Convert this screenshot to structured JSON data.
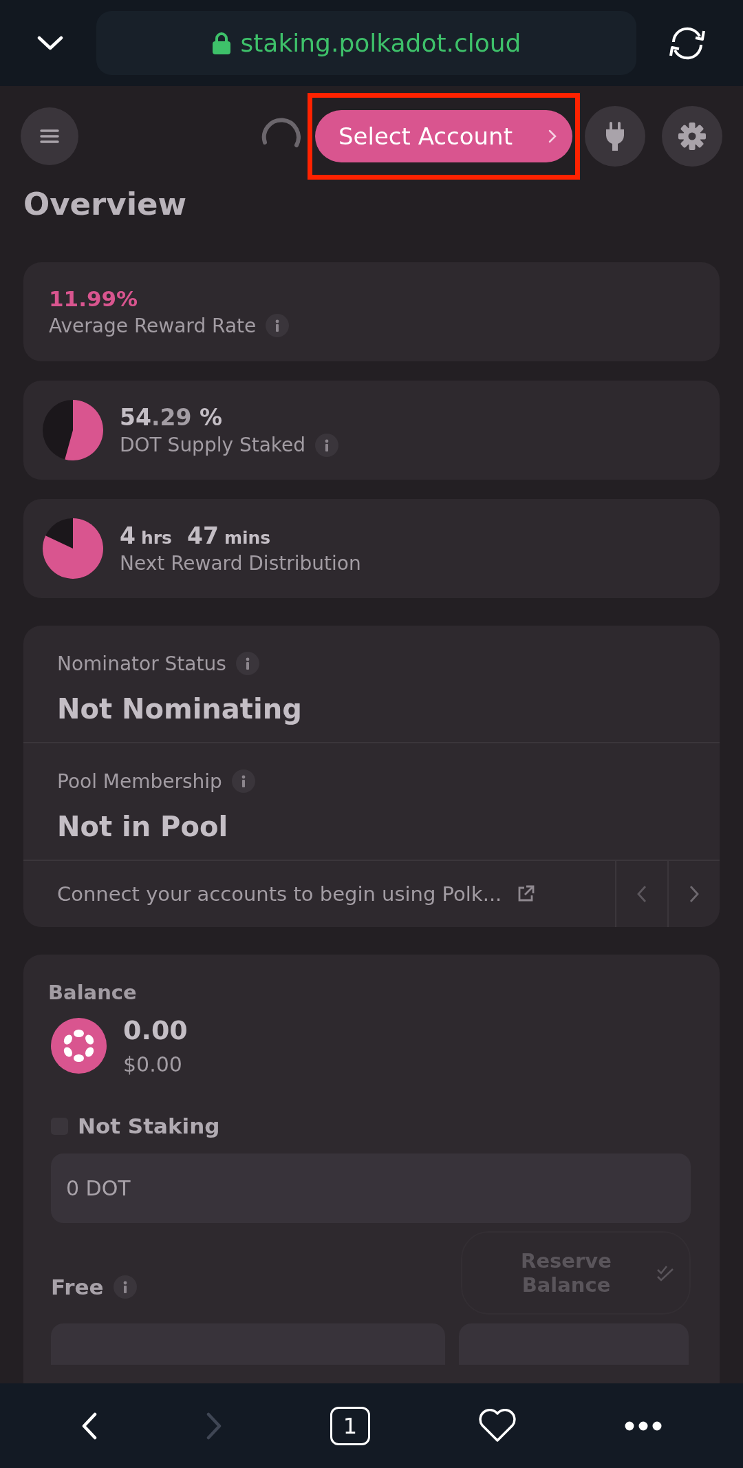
{
  "browser": {
    "url": "staking.polkadot.cloud",
    "secure": true
  },
  "header": {
    "loading": true,
    "account_button": "Select Account",
    "highlighted": true
  },
  "title": "Overview",
  "stats": [
    {
      "kind": "rate",
      "value": "11.99%",
      "label": "Average Reward Rate",
      "info": true
    },
    {
      "kind": "pie",
      "value": "54",
      "decimals": ".29",
      "unit": "%",
      "label": "DOT Supply Staked",
      "info": true
    },
    {
      "kind": "timer",
      "parts": [
        {
          "number": "4",
          "unit": "hrs"
        },
        {
          "number": "47",
          "unit": "mins"
        }
      ],
      "label": "Next Reward Distribution",
      "info": false
    }
  ],
  "status": {
    "rows": [
      {
        "label": "Nominator Status",
        "value": "Not Nominating"
      },
      {
        "label": "Pool Membership",
        "value": "Not in Pool"
      }
    ],
    "message": "Connect your accounts to begin using Polk..."
  },
  "balance": {
    "title": "Balance",
    "amount": "0.00",
    "fiat": "$0.00",
    "legend": "Not Staking",
    "staked": "0 DOT",
    "free_label": "Free",
    "reserve_button": {
      "label": "Reserve Balance",
      "disabled": true
    }
  },
  "nav": {
    "tab_count": "1",
    "forward_disabled": true
  }
}
